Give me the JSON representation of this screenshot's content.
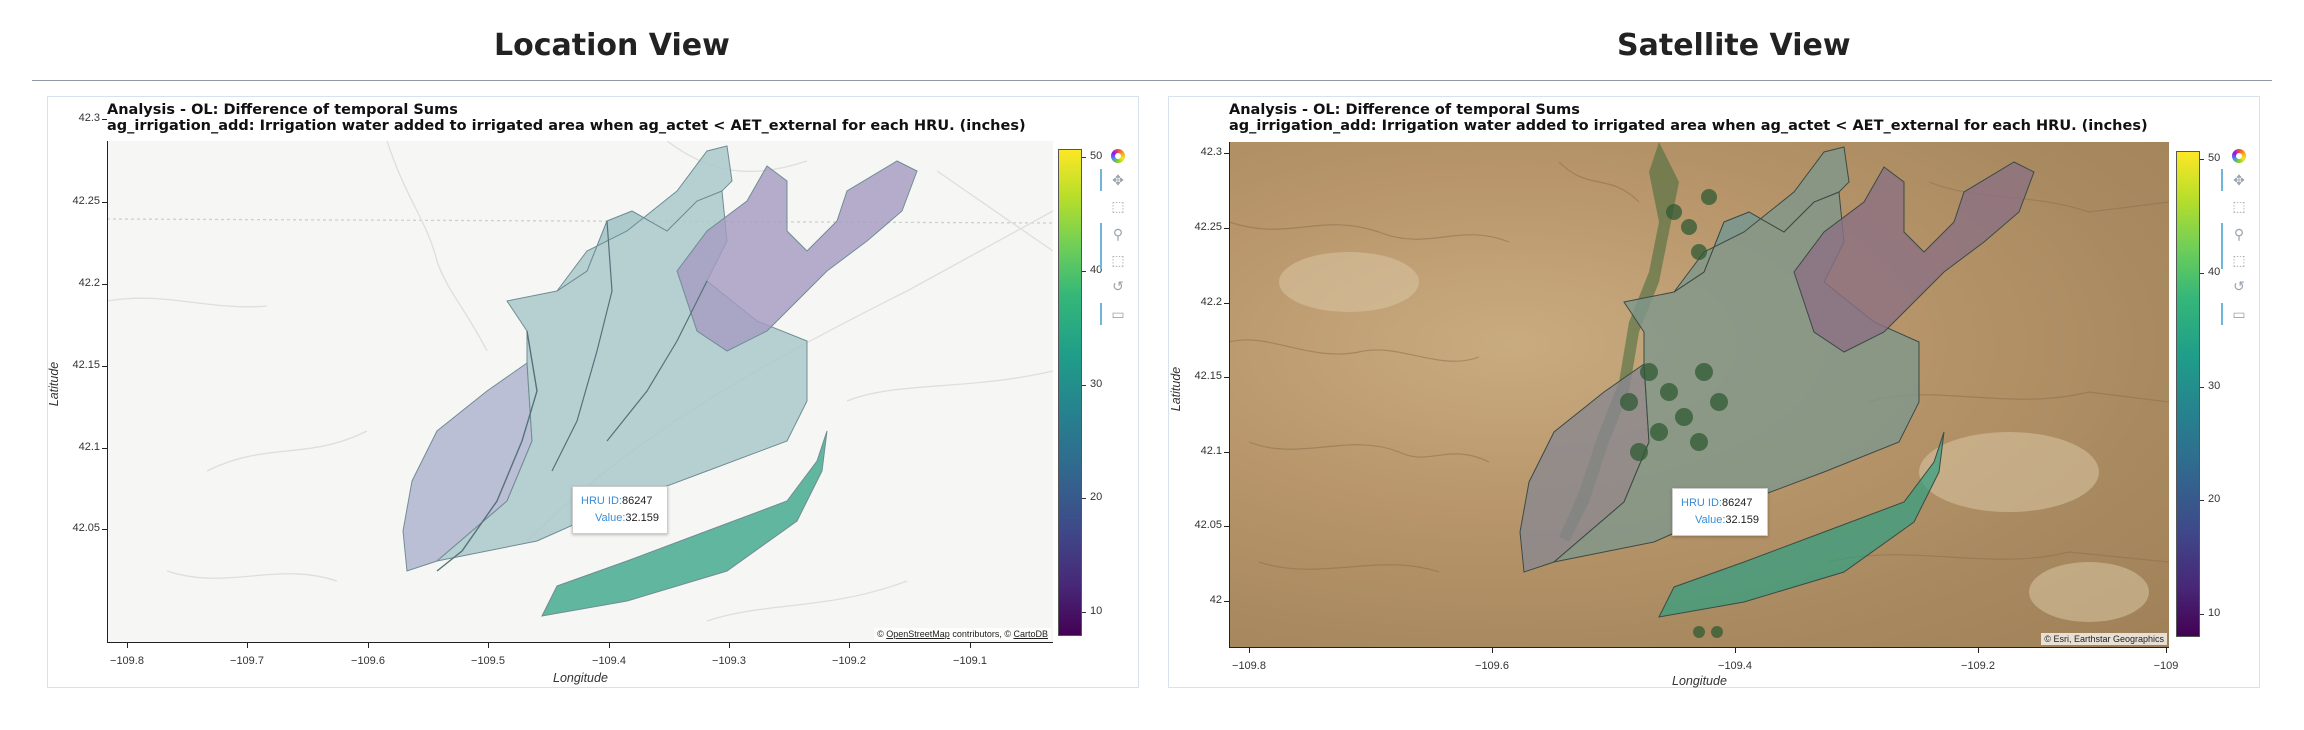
{
  "views": [
    {
      "heading": "Location View",
      "basemap": "light",
      "plot_title_line1": "Analysis - OL: Difference of temporal Sums",
      "plot_title_line2": "ag_irrigation_add: Irrigation water added to irrigated area when ag_actet < AET_external for each HRU. (inches)",
      "xlabel": "Longitude",
      "ylabel": "Latitude",
      "yticks": [
        "42.3",
        "42.25",
        "42.2",
        "42.15",
        "42.1",
        "42.05"
      ],
      "xticks": [
        "−109.8",
        "−109.7",
        "−109.6",
        "−109.5",
        "−109.4",
        "−109.3",
        "−109.2",
        "−109.1"
      ],
      "attribution": {
        "prefix": "© ",
        "link1": "OpenStreetMap",
        "mid": " contributors, © ",
        "link2": "CartoDB"
      },
      "tooltip": {
        "id_key": "HRU ID:",
        "id_value": "86247",
        "val_key": "Value:",
        "val_value": "32.159"
      }
    },
    {
      "heading": "Satellite View",
      "basemap": "satellite",
      "plot_title_line1": "Analysis - OL: Difference of temporal Sums",
      "plot_title_line2": "ag_irrigation_add: Irrigation water added to irrigated area when ag_actet < AET_external for each HRU. (inches)",
      "xlabel": "Longitude",
      "ylabel": "Latitude",
      "yticks": [
        "42.3",
        "42.25",
        "42.2",
        "42.15",
        "42.1",
        "42.05",
        "42"
      ],
      "xticks": [
        "−109.8",
        "−109.6",
        "−109.4",
        "−109.2",
        "−109"
      ],
      "attribution": {
        "prefix": "© Esri, Earthstar Geographics",
        "link1": "",
        "mid": "",
        "link2": ""
      },
      "tooltip": {
        "id_key": "HRU ID:",
        "id_value": "86247",
        "val_key": "Value:",
        "val_value": "32.159"
      }
    }
  ],
  "colorbar": {
    "colormap": "viridis",
    "ticks": [
      "50",
      "40",
      "30",
      "20",
      "10"
    ],
    "range": [
      8,
      51
    ]
  },
  "toolbar_icons": [
    "bokeh-logo-icon",
    "pan-icon",
    "box-zoom-icon",
    "wheel-zoom-icon",
    "box-select-icon",
    "reset-icon",
    "hover-icon"
  ],
  "colors": {
    "hru_high": "#2fa083",
    "hru_mid": "#aac9cb",
    "hru_low": "#b0b5d0",
    "hru_purple": "#a59ac2",
    "accent": "#3a8dd4"
  }
}
